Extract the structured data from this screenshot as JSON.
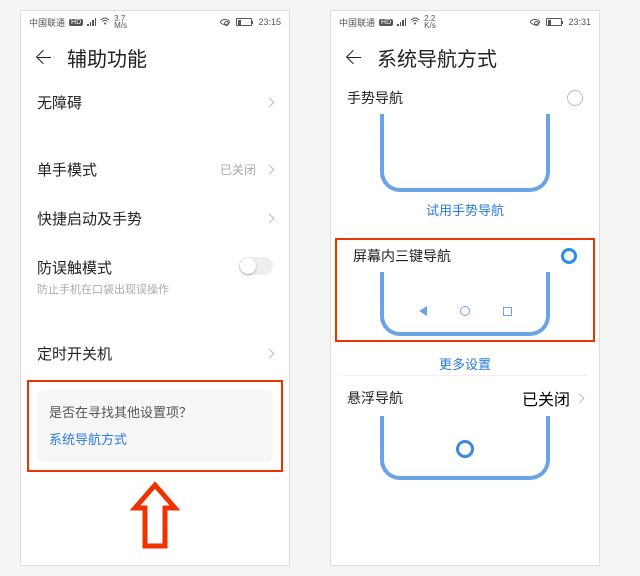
{
  "left": {
    "status": {
      "carrier": "中国联通",
      "hd": "HD",
      "rate_top": "3.7",
      "rate_bot": "M/s",
      "time": "23:15",
      "battery_pct": 22
    },
    "title": "辅助功能",
    "rows": {
      "access": "无障碍",
      "one_hand": "单手模式",
      "one_hand_status": "已关闭",
      "quick": "快捷启动及手势",
      "mistouch": "防误触模式",
      "mistouch_sub": "防止手机在口袋出现误操作",
      "timer": "定时开关机"
    },
    "card": {
      "q": "是否在寻找其他设置项？",
      "link": "系统导航方式"
    }
  },
  "right": {
    "status": {
      "carrier": "中国联通",
      "hd": "HD",
      "rate_top": "2.2",
      "rate_bot": "K/s",
      "time": "23:31",
      "battery_pct": 22
    },
    "title": "系统导航方式",
    "opts": {
      "gesture": "手势导航",
      "gesture_link": "试用手势导航",
      "threekey": "屏幕内三键导航",
      "more": "更多设置",
      "float": "悬浮导航",
      "float_status": "已关闭"
    }
  }
}
